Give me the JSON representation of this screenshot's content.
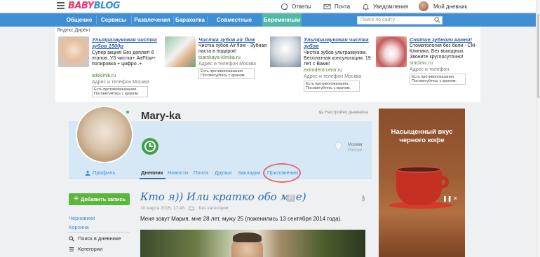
{
  "header": {
    "logo_part1": "BABY",
    "logo_part2": "BLOG",
    "answers_label": "Ответы",
    "mail_label": "Почта",
    "notifications_label": "Уведомления",
    "diary_label": "Мой дневник"
  },
  "nav": {
    "items": [
      "Общение",
      "Сервисы",
      "Развлечения",
      "Барахолка",
      "Совместные покупки",
      "Беременным"
    ],
    "search_placeholder": "Поиск по сайту"
  },
  "ads": {
    "label": "Яндекс.Директ",
    "items": [
      {
        "title": "Ультразвуковая чистка зубов 1500р",
        "desc": "Супер акция! Без доплат! 6 этапов. УЗ чистка+ AirFlow+ полировка + цифро..+",
        "url": "allsklinik.ru",
        "addr": "Адрес и телефон   Москва",
        "warn": "Есть противопоказания. Посоветуйтесь с врачом."
      },
      {
        "title": "Чистка зубов air flow",
        "desc": "Чистка зубов Air flow - Зубная паста в подарок!",
        "url": "tsarskaya-klinika.ru",
        "addr": "Адрес и телефон   Москва",
        "warn": "Есть противопоказания. Посоветуйтесь с врачом."
      },
      {
        "title": "Ультразвуковая чистка зубов",
        "desc": "Чистка зубов ультразвуком. Бесплатная консультация. 19 лет с Вами!",
        "url": "extrodent-centr.ru",
        "addr": "Адрес и телефон   Москва",
        "warn": "Есть противопоказания. Посоветуйтесь с врачом."
      },
      {
        "title": "Снятие зубного камня!",
        "desc": "Стоматология без боли - СМ-Клиника. Без выходных. Звоните круглосуточно!",
        "url": "smclinic.ru",
        "addr": "Адрес и телефон",
        "warn": "Есть противопоказания. Посоветуйтесь с врачом."
      }
    ]
  },
  "profile": {
    "name": "Mary-ka",
    "settings_label": "Настройки дневника",
    "city": "Москва",
    "country": "Россия",
    "profile_link": "Профиль",
    "tabs": [
      "Дневник",
      "Новости",
      "Почта",
      "Друзья",
      "Закладки",
      "Приложения"
    ]
  },
  "sidebar": {
    "add_button": "Добавить запись",
    "drafts": "Черновики",
    "trash": "Корзина",
    "search_diary": "Поиск в дневнике",
    "categories": "Категории"
  },
  "post": {
    "title": "Кто я)) Или кратко обо мне)",
    "comments": "27",
    "date": "10 марта 2015, 17:45",
    "category": "Без категории",
    "body": "Меня зовут Мария, мне 28 лет, мужу 25 (поженились 13 сентября 2014 года)."
  },
  "coffee_ad": {
    "text": "Насыщенный вкус черного кофе"
  }
}
